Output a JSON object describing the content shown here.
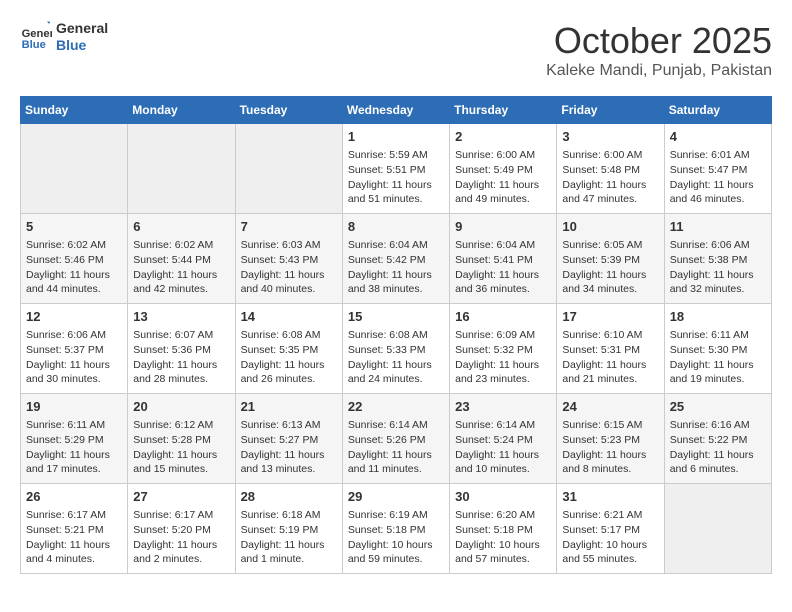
{
  "header": {
    "logo_line1": "General",
    "logo_line2": "Blue",
    "title": "October 2025",
    "subtitle": "Kaleke Mandi, Punjab, Pakistan"
  },
  "weekdays": [
    "Sunday",
    "Monday",
    "Tuesday",
    "Wednesday",
    "Thursday",
    "Friday",
    "Saturday"
  ],
  "weeks": [
    [
      {
        "day": "",
        "info": ""
      },
      {
        "day": "",
        "info": ""
      },
      {
        "day": "",
        "info": ""
      },
      {
        "day": "1",
        "info": "Sunrise: 5:59 AM\nSunset: 5:51 PM\nDaylight: 11 hours\nand 51 minutes."
      },
      {
        "day": "2",
        "info": "Sunrise: 6:00 AM\nSunset: 5:49 PM\nDaylight: 11 hours\nand 49 minutes."
      },
      {
        "day": "3",
        "info": "Sunrise: 6:00 AM\nSunset: 5:48 PM\nDaylight: 11 hours\nand 47 minutes."
      },
      {
        "day": "4",
        "info": "Sunrise: 6:01 AM\nSunset: 5:47 PM\nDaylight: 11 hours\nand 46 minutes."
      }
    ],
    [
      {
        "day": "5",
        "info": "Sunrise: 6:02 AM\nSunset: 5:46 PM\nDaylight: 11 hours\nand 44 minutes."
      },
      {
        "day": "6",
        "info": "Sunrise: 6:02 AM\nSunset: 5:44 PM\nDaylight: 11 hours\nand 42 minutes."
      },
      {
        "day": "7",
        "info": "Sunrise: 6:03 AM\nSunset: 5:43 PM\nDaylight: 11 hours\nand 40 minutes."
      },
      {
        "day": "8",
        "info": "Sunrise: 6:04 AM\nSunset: 5:42 PM\nDaylight: 11 hours\nand 38 minutes."
      },
      {
        "day": "9",
        "info": "Sunrise: 6:04 AM\nSunset: 5:41 PM\nDaylight: 11 hours\nand 36 minutes."
      },
      {
        "day": "10",
        "info": "Sunrise: 6:05 AM\nSunset: 5:39 PM\nDaylight: 11 hours\nand 34 minutes."
      },
      {
        "day": "11",
        "info": "Sunrise: 6:06 AM\nSunset: 5:38 PM\nDaylight: 11 hours\nand 32 minutes."
      }
    ],
    [
      {
        "day": "12",
        "info": "Sunrise: 6:06 AM\nSunset: 5:37 PM\nDaylight: 11 hours\nand 30 minutes."
      },
      {
        "day": "13",
        "info": "Sunrise: 6:07 AM\nSunset: 5:36 PM\nDaylight: 11 hours\nand 28 minutes."
      },
      {
        "day": "14",
        "info": "Sunrise: 6:08 AM\nSunset: 5:35 PM\nDaylight: 11 hours\nand 26 minutes."
      },
      {
        "day": "15",
        "info": "Sunrise: 6:08 AM\nSunset: 5:33 PM\nDaylight: 11 hours\nand 24 minutes."
      },
      {
        "day": "16",
        "info": "Sunrise: 6:09 AM\nSunset: 5:32 PM\nDaylight: 11 hours\nand 23 minutes."
      },
      {
        "day": "17",
        "info": "Sunrise: 6:10 AM\nSunset: 5:31 PM\nDaylight: 11 hours\nand 21 minutes."
      },
      {
        "day": "18",
        "info": "Sunrise: 6:11 AM\nSunset: 5:30 PM\nDaylight: 11 hours\nand 19 minutes."
      }
    ],
    [
      {
        "day": "19",
        "info": "Sunrise: 6:11 AM\nSunset: 5:29 PM\nDaylight: 11 hours\nand 17 minutes."
      },
      {
        "day": "20",
        "info": "Sunrise: 6:12 AM\nSunset: 5:28 PM\nDaylight: 11 hours\nand 15 minutes."
      },
      {
        "day": "21",
        "info": "Sunrise: 6:13 AM\nSunset: 5:27 PM\nDaylight: 11 hours\nand 13 minutes."
      },
      {
        "day": "22",
        "info": "Sunrise: 6:14 AM\nSunset: 5:26 PM\nDaylight: 11 hours\nand 11 minutes."
      },
      {
        "day": "23",
        "info": "Sunrise: 6:14 AM\nSunset: 5:24 PM\nDaylight: 11 hours\nand 10 minutes."
      },
      {
        "day": "24",
        "info": "Sunrise: 6:15 AM\nSunset: 5:23 PM\nDaylight: 11 hours\nand 8 minutes."
      },
      {
        "day": "25",
        "info": "Sunrise: 6:16 AM\nSunset: 5:22 PM\nDaylight: 11 hours\nand 6 minutes."
      }
    ],
    [
      {
        "day": "26",
        "info": "Sunrise: 6:17 AM\nSunset: 5:21 PM\nDaylight: 11 hours\nand 4 minutes."
      },
      {
        "day": "27",
        "info": "Sunrise: 6:17 AM\nSunset: 5:20 PM\nDaylight: 11 hours\nand 2 minutes."
      },
      {
        "day": "28",
        "info": "Sunrise: 6:18 AM\nSunset: 5:19 PM\nDaylight: 11 hours\nand 1 minute."
      },
      {
        "day": "29",
        "info": "Sunrise: 6:19 AM\nSunset: 5:18 PM\nDaylight: 10 hours\nand 59 minutes."
      },
      {
        "day": "30",
        "info": "Sunrise: 6:20 AM\nSunset: 5:18 PM\nDaylight: 10 hours\nand 57 minutes."
      },
      {
        "day": "31",
        "info": "Sunrise: 6:21 AM\nSunset: 5:17 PM\nDaylight: 10 hours\nand 55 minutes."
      },
      {
        "day": "",
        "info": ""
      }
    ]
  ]
}
